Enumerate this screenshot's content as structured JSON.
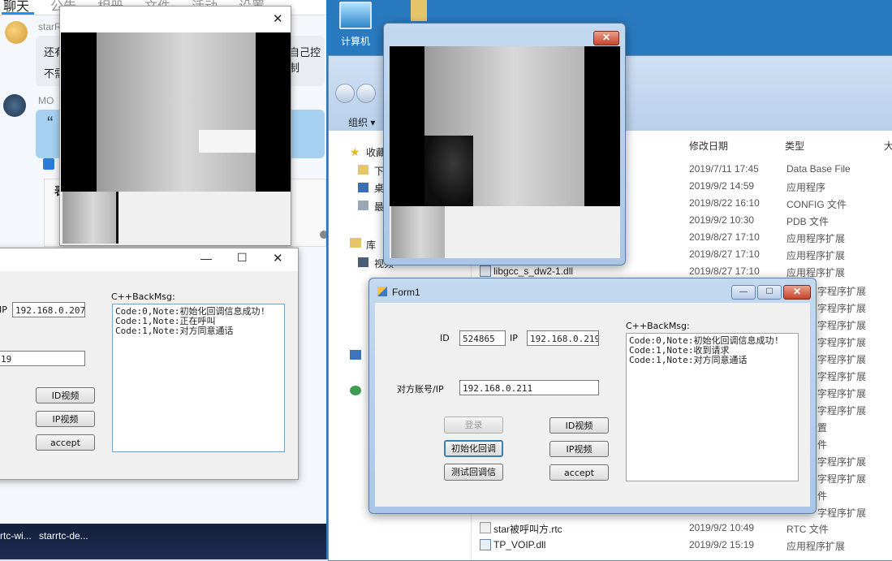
{
  "chat": {
    "tabs": [
      "聊天",
      "公告",
      "相册",
      "文件",
      "活动",
      "设置"
    ],
    "sender1": "starR",
    "msg_line1": "还有",
    "msg_line2": "不需",
    "msg_suffix": "自己控制",
    "sender2": "MO",
    "quote_char": "“",
    "card_char": "表"
  },
  "taskbar": {
    "items": [
      "rtc-wi...",
      "starrtc-de..."
    ]
  },
  "desktop": {
    "computer_label": "计算机"
  },
  "explorer": {
    "organize": "组织 ▾",
    "nav": [
      "收藏",
      "下",
      "桌",
      "最",
      "库",
      "视频"
    ],
    "columns": {
      "date": "修改日期",
      "type": "类型",
      "size": "大"
    },
    "files": [
      {
        "name": "",
        "date": "2019/7/11 17:45",
        "type": "Data Base File"
      },
      {
        "name": "",
        "date": "2019/9/2 14:59",
        "type": "应用程序"
      },
      {
        "name": "",
        "date": "2019/8/22 16:10",
        "type": "CONFIG 文件"
      },
      {
        "name": "",
        "date": "2019/9/2 10:30",
        "type": "PDB 文件"
      },
      {
        "name": "",
        "date": "2019/8/27 17:10",
        "type": "应用程序扩展"
      },
      {
        "name": "",
        "date": "2019/8/27 17:10",
        "type": "应用程序扩展"
      },
      {
        "name": "libgcc_s_dw2-1.dll",
        "date": "2019/8/27 17:10",
        "type": "应用程序扩展"
      }
    ],
    "side_types": [
      "字程序扩展",
      "字程序扩展",
      "字程序扩展",
      "字程序扩展",
      "字程序扩展",
      "字程序扩展",
      "字程序扩展",
      "字程序扩展",
      "置",
      "件",
      "字程序扩展",
      "字程序扩展",
      "件",
      "字程序扩展"
    ],
    "bottom_files": [
      {
        "name": "star被呼叫方.rtc",
        "date": "2019/9/2 10:49",
        "type": "RTC 文件"
      },
      {
        "name": "TP_VOIP.dll",
        "date": "2019/9/2 15:19",
        "type": "应用程序扩展"
      }
    ]
  },
  "form_left": {
    "ip_label": "IP",
    "ip_value": "192.168.0.207",
    "peer_value": "19",
    "backmsg_label": "C++BackMsg:",
    "messages": [
      "Code:0,Note:初始化回调信息成功!",
      "Code:1,Note:正在呼叫",
      "Code:1,Note:对方同意通话"
    ],
    "btn_id_video": "ID视频",
    "btn_ip_video": "IP视频",
    "btn_accept": "accept"
  },
  "form_right": {
    "title": "Form1",
    "id_label": "ID",
    "id_value": "524865",
    "ip_label": "IP",
    "ip_value": "192.168.0.219",
    "peer_label": "对方账号/IP",
    "peer_value": "192.168.0.211",
    "btn_login": "登录",
    "btn_init": "初始化回调",
    "btn_test": "测试回调信",
    "btn_id_video": "ID视频",
    "btn_ip_video": "IP视频",
    "btn_accept": "accept",
    "backmsg_label": "C++BackMsg:",
    "messages": [
      "Code:0,Note:初始化回调信息成功!",
      "Code:1,Note:收到请求",
      "Code:1,Note:对方同意通话"
    ]
  },
  "video_left": {
    "close": "✕"
  },
  "video_right": {
    "close": "✕"
  },
  "window_controls": {
    "min": "—",
    "max": "☐",
    "close": "✕"
  }
}
